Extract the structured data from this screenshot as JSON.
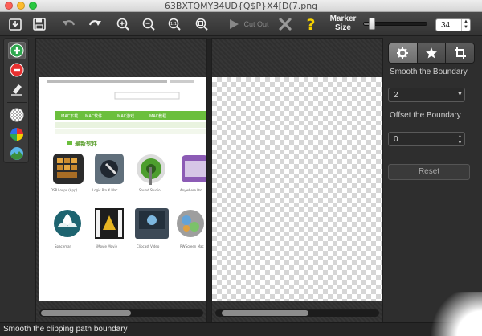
{
  "window": {
    "title": "63BXTQMY34UD{Q$P}X4[D(7.png"
  },
  "toolbar": {
    "cut_out_label": "Cut Out",
    "marker_size_label": "Marker Size",
    "marker_size_value": "34",
    "marker_size_fraction": 0.08,
    "icons": [
      "open-icon",
      "save-icon",
      "undo-icon",
      "redo-icon",
      "zoom-in-icon",
      "zoom-out-icon",
      "actual-size-icon",
      "fit-to-window-icon",
      "play-icon",
      "cancel-x-icon",
      "help-question-icon"
    ]
  },
  "left_tools": {
    "icons": [
      "add-marker-icon",
      "remove-marker-icon",
      "eraser-icon",
      "background-checker-icon",
      "color-wheel-icon",
      "landscape-icon"
    ],
    "active": "add-marker-icon"
  },
  "panel": {
    "tabs": [
      "settings-gear-icon",
      "star-effects-icon",
      "crop-icon"
    ],
    "active_tab": "settings-gear-icon",
    "smooth_label": "Smooth the Boundary",
    "smooth_value": "2",
    "offset_label": "Offset the Boundary",
    "offset_value": "0",
    "reset_label": "Reset"
  },
  "website": {
    "nav_items": [
      "MAC下载",
      "MAC软件",
      "MAC游戏",
      "MAC教程"
    ],
    "section_title": "最新软件",
    "apps": [
      {
        "label": "DSP Loops (App)"
      },
      {
        "label": "Logic Pro X Mac"
      },
      {
        "label": "Sound Studio"
      },
      {
        "label": "Anywhere Pro"
      },
      {
        "label": "Spaceman"
      },
      {
        "label": "iMovie Movie"
      },
      {
        "label": "Clipcast Video"
      },
      {
        "label": "RWScreen Mac"
      }
    ]
  },
  "status": {
    "text": "Smooth the clipping path boundary"
  },
  "colors": {
    "accent_green": "#2fa84f",
    "accent_red": "#e83030",
    "help_yellow": "#f5d100",
    "site_green": "#6bbf3d"
  }
}
